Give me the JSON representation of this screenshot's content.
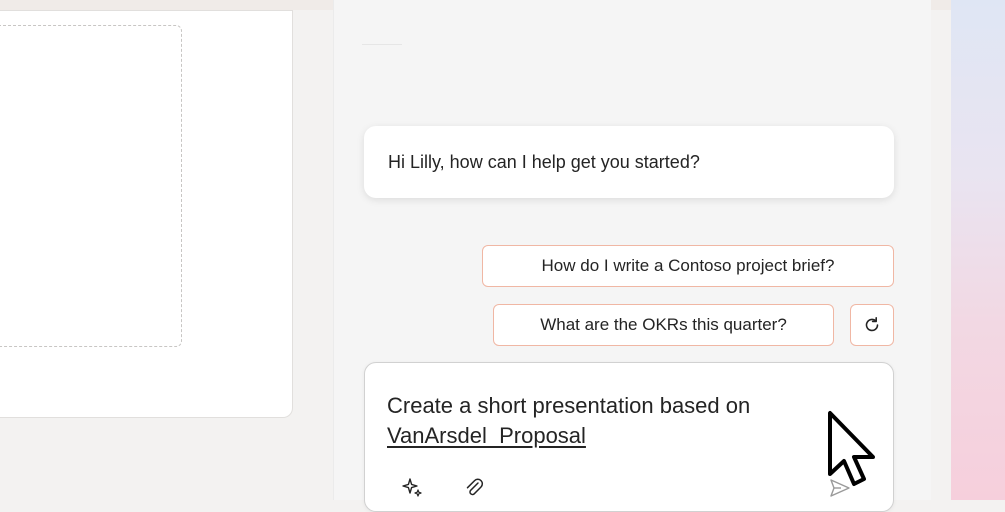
{
  "colors": {
    "accent_border": "#f0b7a4",
    "text": "#242424",
    "pane_background": "#f5f5f5"
  },
  "copilot": {
    "greeting": "Hi Lilly, how can I help get you started?",
    "suggestions": [
      "How do I write a Contoso project brief?",
      "What are the OKRs this quarter?"
    ],
    "refresh_icon": "refresh-icon",
    "compose": {
      "text": "Create a short presentation based on",
      "file_reference": "VanArsdel_Proposal",
      "icons": [
        "sparkle-icon",
        "attach-icon",
        "send-icon"
      ]
    }
  }
}
